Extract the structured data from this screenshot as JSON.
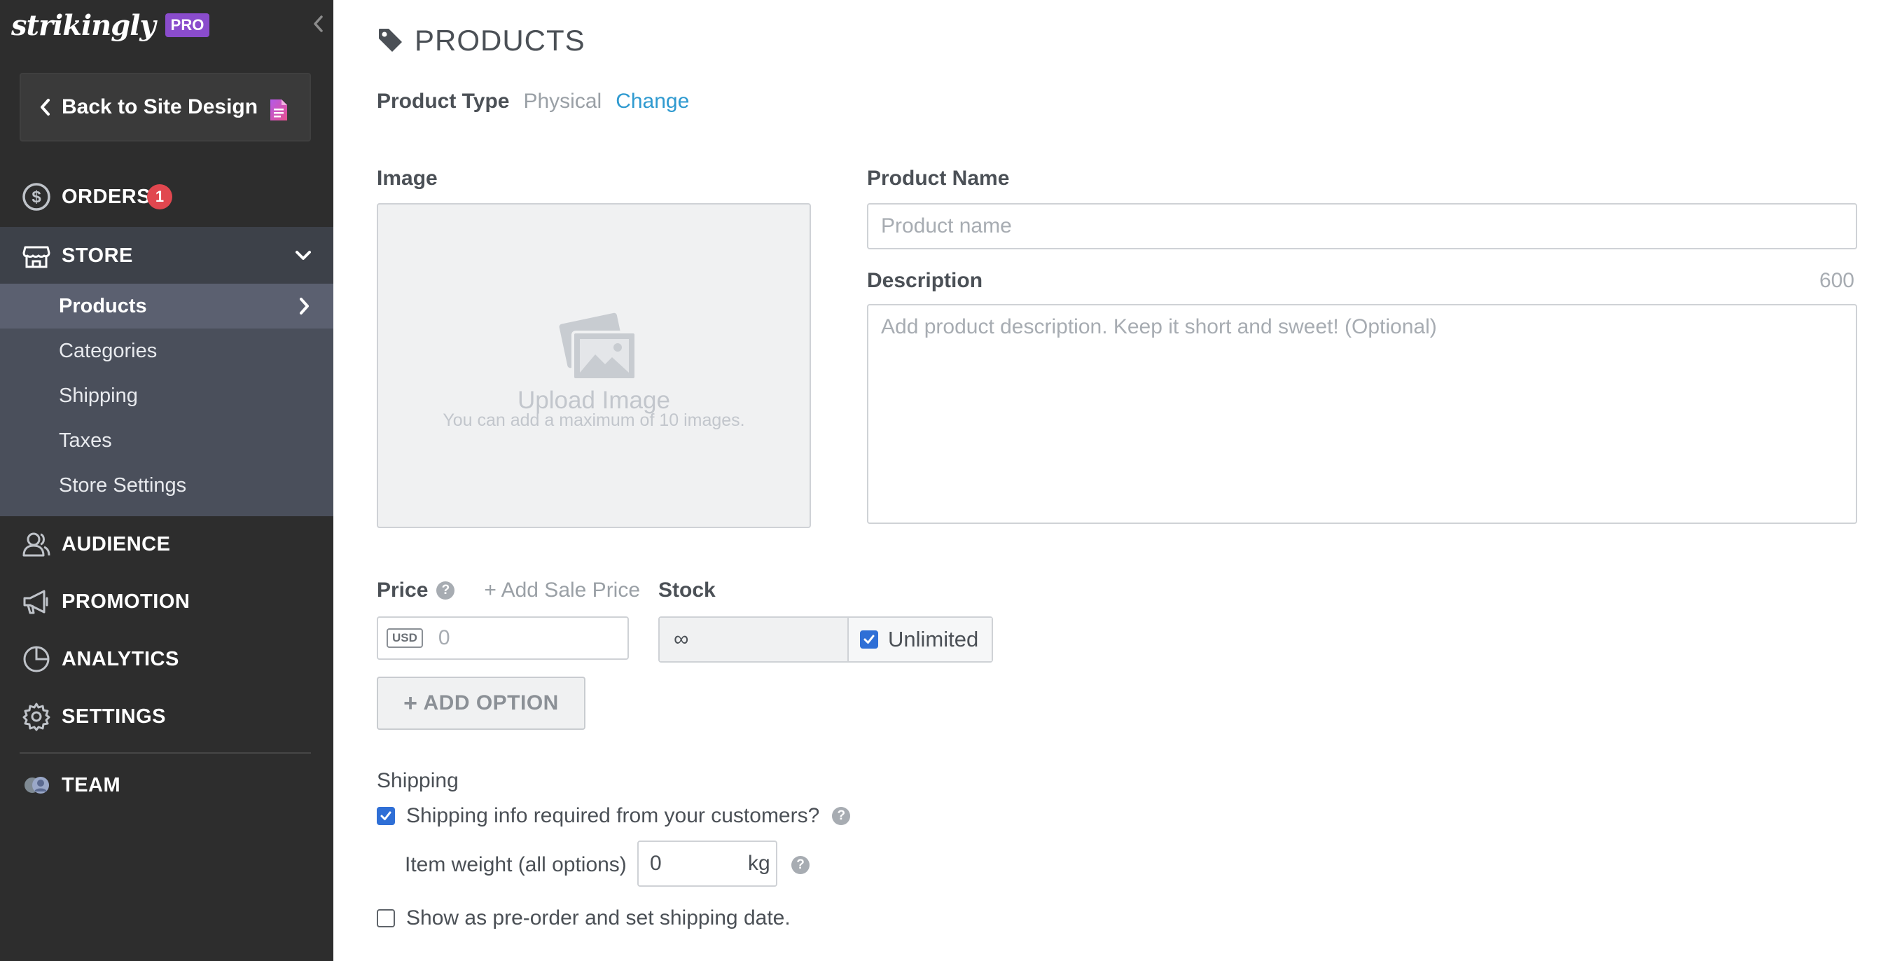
{
  "sidebar": {
    "brand": "strikingly",
    "pro_badge": "PRO",
    "back_label": "Back to Site Design",
    "orders": {
      "label": "ORDERS",
      "badge": "1"
    },
    "store": {
      "label": "STORE"
    },
    "store_submenu": [
      "Products",
      "Categories",
      "Shipping",
      "Taxes",
      "Store Settings"
    ],
    "audience": "AUDIENCE",
    "promotion": "PROMOTION",
    "analytics": "ANALYTICS",
    "settings": "SETTINGS",
    "team": "TEAM"
  },
  "main": {
    "title": "PRODUCTS",
    "product_type": {
      "label": "Product Type",
      "value": "Physical",
      "change": "Change"
    },
    "image": {
      "label": "Image",
      "upload_title": "Upload Image",
      "upload_sub": "You can add a maximum of 10 images."
    },
    "product_name": {
      "label": "Product Name",
      "placeholder": "Product name"
    },
    "description": {
      "label": "Description",
      "count": "600",
      "placeholder": "Add product description. Keep it short and sweet! (Optional)"
    },
    "price": {
      "label": "Price",
      "sale_link": "+ Add Sale Price",
      "currency": "USD",
      "placeholder": "0"
    },
    "stock": {
      "label": "Stock",
      "value": "∞",
      "unlimited_label": "Unlimited",
      "unlimited_checked": true
    },
    "add_option": "ADD OPTION",
    "shipping": {
      "label": "Shipping",
      "required_label": "Shipping info required from your customers?",
      "required_checked": true,
      "weight_label": "Item weight (all options)",
      "weight_value": "0",
      "weight_unit": "kg",
      "preorder_label": "Show as pre-order and set shipping date.",
      "preorder_checked": false
    }
  },
  "colors": {
    "sidebar_bg": "#2d2d2d",
    "store_submenu_bg": "#4a4f5b",
    "pro_purple": "#8a4ccc",
    "badge_red": "#e1474f",
    "link_blue": "#2f9ad0",
    "checkbox_blue": "#2f6fd6"
  }
}
